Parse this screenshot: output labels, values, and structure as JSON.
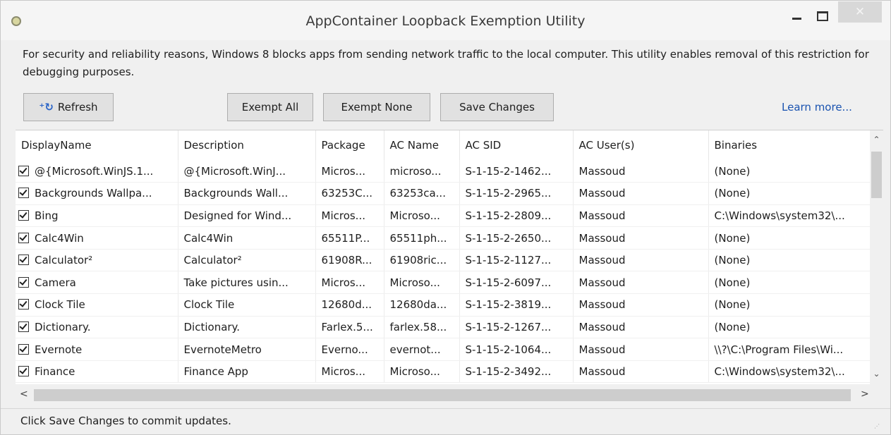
{
  "window": {
    "title": "AppContainer Loopback Exemption Utility",
    "close_glyph": "✕"
  },
  "info_text": "For security and reliability reasons, Windows 8 blocks apps from sending network traffic to the local computer. This utility enables removal of this restriction for debugging purposes.",
  "toolbar": {
    "refresh_label": "Refresh",
    "exempt_all_label": "Exempt All",
    "exempt_none_label": "Exempt None",
    "save_changes_label": "Save Changes",
    "learn_more_label": "Learn more..."
  },
  "table": {
    "columns": [
      "DisplayName",
      "Description",
      "Package",
      "AC Name",
      "AC SID",
      "AC User(s)",
      "Binaries"
    ],
    "rows": [
      {
        "checked": true,
        "cells": [
          "@{Microsoft.WinJS.1...",
          "@{Microsoft.WinJ...",
          "Micros...",
          "microso...",
          "S-1-15-2-1462...",
          "Massoud",
          "(None)"
        ]
      },
      {
        "checked": true,
        "cells": [
          "Backgrounds Wallpa...",
          "Backgrounds Wall...",
          "63253C...",
          "63253ca...",
          "S-1-15-2-2965...",
          "Massoud",
          "(None)"
        ]
      },
      {
        "checked": true,
        "cells": [
          "Bing",
          "Designed for Wind...",
          "Micros...",
          "Microso...",
          "S-1-15-2-2809...",
          "Massoud",
          "C:\\Windows\\system32\\..."
        ]
      },
      {
        "checked": true,
        "cells": [
          "Calc4Win",
          "Calc4Win",
          "65511P...",
          "65511ph...",
          "S-1-15-2-2650...",
          "Massoud",
          "(None)"
        ]
      },
      {
        "checked": true,
        "cells": [
          "Calculator²",
          "Calculator²",
          "61908R...",
          "61908ric...",
          "S-1-15-2-1127...",
          "Massoud",
          "(None)"
        ]
      },
      {
        "checked": true,
        "cells": [
          "Camera",
          "Take pictures usin...",
          "Micros...",
          "Microso...",
          "S-1-15-2-6097...",
          "Massoud",
          "(None)"
        ]
      },
      {
        "checked": true,
        "cells": [
          "Clock Tile",
          "Clock Tile",
          "12680d...",
          "12680da...",
          "S-1-15-2-3819...",
          "Massoud",
          "(None)"
        ]
      },
      {
        "checked": true,
        "cells": [
          "Dictionary.",
          "Dictionary.",
          "Farlex.5...",
          "farlex.58...",
          "S-1-15-2-1267...",
          "Massoud",
          "(None)"
        ]
      },
      {
        "checked": true,
        "cells": [
          "Evernote",
          "EvernoteMetro",
          "Everno...",
          "evernot...",
          "S-1-15-2-1064...",
          "Massoud",
          "\\\\?\\C:\\Program Files\\Wi..."
        ]
      },
      {
        "checked": true,
        "cells": [
          "Finance",
          "Finance App",
          "Micros...",
          "Microso...",
          "S-1-15-2-3492...",
          "Massoud",
          "C:\\Windows\\system32\\..."
        ]
      }
    ]
  },
  "status_text": "Click Save Changes to commit updates.",
  "icons": {
    "refresh": "refresh-icon",
    "scroll_up": "chevron-up-icon",
    "scroll_down": "chevron-down-icon",
    "scroll_left": "chevron-left-icon",
    "scroll_right": "chevron-right-icon"
  },
  "colors": {
    "link": "#1a53b0",
    "accent_refresh": "#2b64c7"
  }
}
